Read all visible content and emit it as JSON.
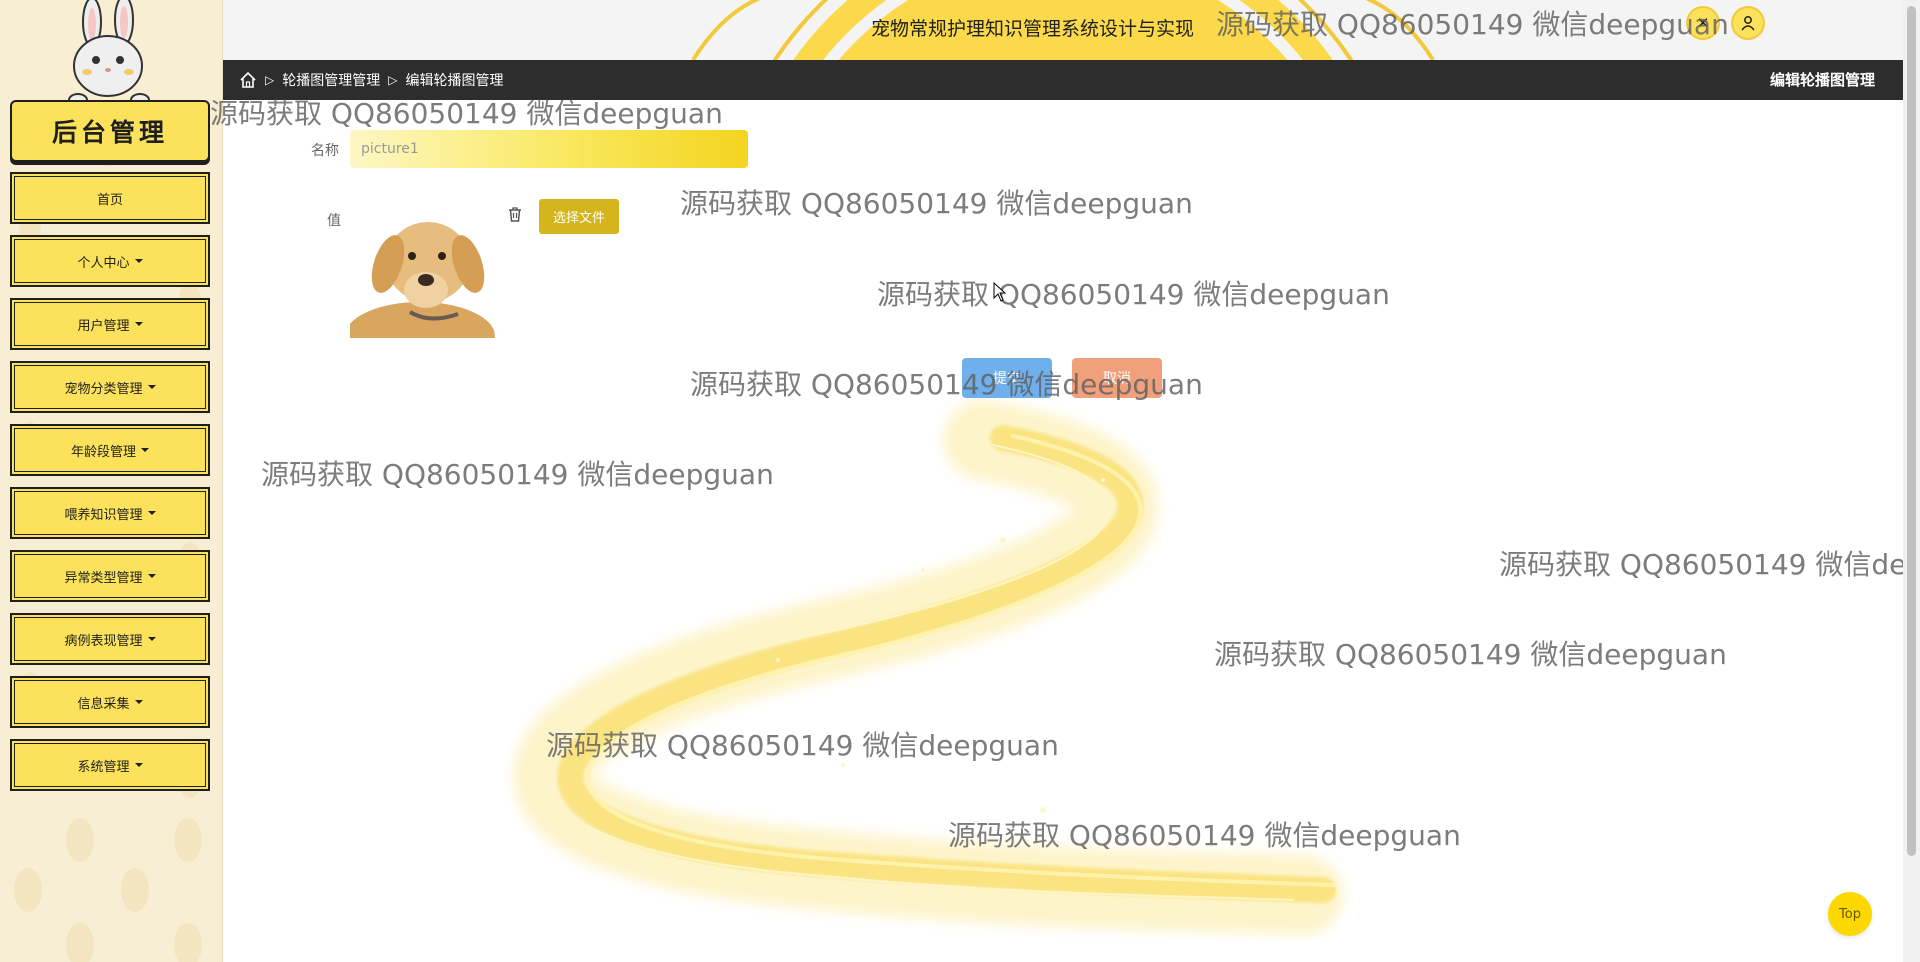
{
  "sidebar": {
    "brand": "后台管理",
    "menu": [
      {
        "label": "首页",
        "has_dropdown": false
      },
      {
        "label": "个人中心",
        "has_dropdown": true
      },
      {
        "label": "用户管理",
        "has_dropdown": true
      },
      {
        "label": "宠物分类管理",
        "has_dropdown": true
      },
      {
        "label": "年龄段管理",
        "has_dropdown": true
      },
      {
        "label": "喂养知识管理",
        "has_dropdown": true
      },
      {
        "label": "异常类型管理",
        "has_dropdown": true
      },
      {
        "label": "病例表现管理",
        "has_dropdown": true
      },
      {
        "label": "信息采集",
        "has_dropdown": true
      },
      {
        "label": "系统管理",
        "has_dropdown": true
      }
    ]
  },
  "header": {
    "title": "宠物常规护理知识管理系统设计与实现",
    "close_icon": "close-icon",
    "user_icon": "user-icon"
  },
  "breadcrumb": {
    "items": [
      "轮播图管理管理",
      "编辑轮播图管理"
    ],
    "page_title": "编辑轮播图管理"
  },
  "form": {
    "name_label": "名称",
    "name_value": "picture1",
    "value_label": "值",
    "image_alt": "dog",
    "choose_file_label": "选择文件",
    "submit_label": "提交",
    "cancel_label": "取消"
  },
  "watermark": "源码获取 QQ86050149 微信deepguan",
  "top_button_label": "Top",
  "colors": {
    "accent_yellow": "#fbe25a",
    "submit_blue": "#6fb0ec",
    "cancel_orange": "#f0a07b",
    "file_button": "#d4b51c",
    "breadcrumb_bar": "#2d2d2d"
  }
}
